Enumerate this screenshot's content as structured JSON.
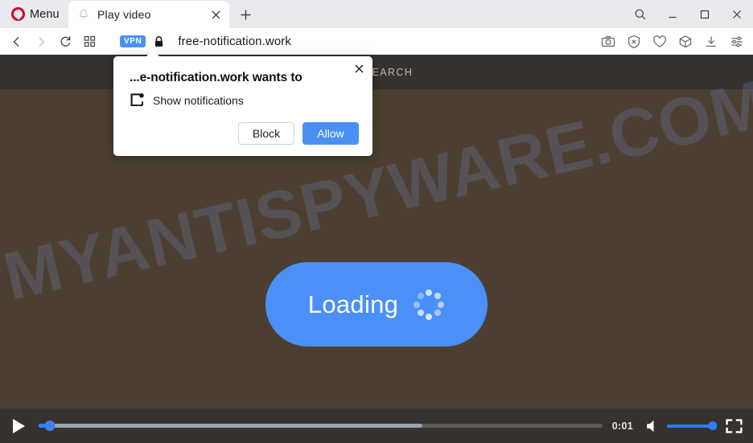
{
  "browser": {
    "name": "Opera",
    "menu_label": "Menu",
    "logo_icon": "opera-logo-icon",
    "tab": {
      "title": "Play video",
      "favicon": "bell-favicon-icon",
      "close_icon": "close-icon"
    },
    "new_tab_icon": "plus-icon",
    "window_controls": [
      {
        "name": "search-icon",
        "label": ""
      },
      {
        "name": "minimize-icon",
        "label": ""
      },
      {
        "name": "maximize-icon",
        "label": ""
      },
      {
        "name": "close-window-icon",
        "label": ""
      }
    ],
    "address_bar": {
      "back_icon": "back-arrow-icon",
      "forward_icon": "forward-arrow-icon",
      "reload_icon": "reload-icon",
      "speeddial_icon": "grid-icon",
      "vpn_badge": "VPN",
      "vpn_badge_color": "#4a90f4",
      "lock_icon": "padlock-icon",
      "url": "free-notification.work",
      "right_icons": [
        "camera-snapshot-icon",
        "ad-blocker-shield-icon",
        "heart-favorites-icon",
        "cube-workspaces-icon",
        "download-icon",
        "easy-setup-icon"
      ]
    }
  },
  "permission_dialog": {
    "title": "...e-notification.work wants to",
    "permission_icon": "notification-permission-icon",
    "permission_label": "Show notifications",
    "block_label": "Block",
    "allow_label": "Allow",
    "close_icon": "close-icon",
    "allow_color": "#4a90f4"
  },
  "page": {
    "background_color": "#4c3f31",
    "header_color": "#353230",
    "search_label": "SEARCH",
    "watermark": "MYANTISPYWARE.COM",
    "loading_button": {
      "label": "Loading",
      "color": "#4a90f8",
      "spinner_icon": "dot-spinner-icon"
    }
  },
  "video_controls": {
    "play_icon": "play-icon",
    "seek_progress_percent": 2,
    "seek_buffer_percent": 68,
    "time": "0:01",
    "volume_icon": "speaker-icon",
    "volume_percent": 100,
    "fullscreen_icon": "fullscreen-icon"
  }
}
